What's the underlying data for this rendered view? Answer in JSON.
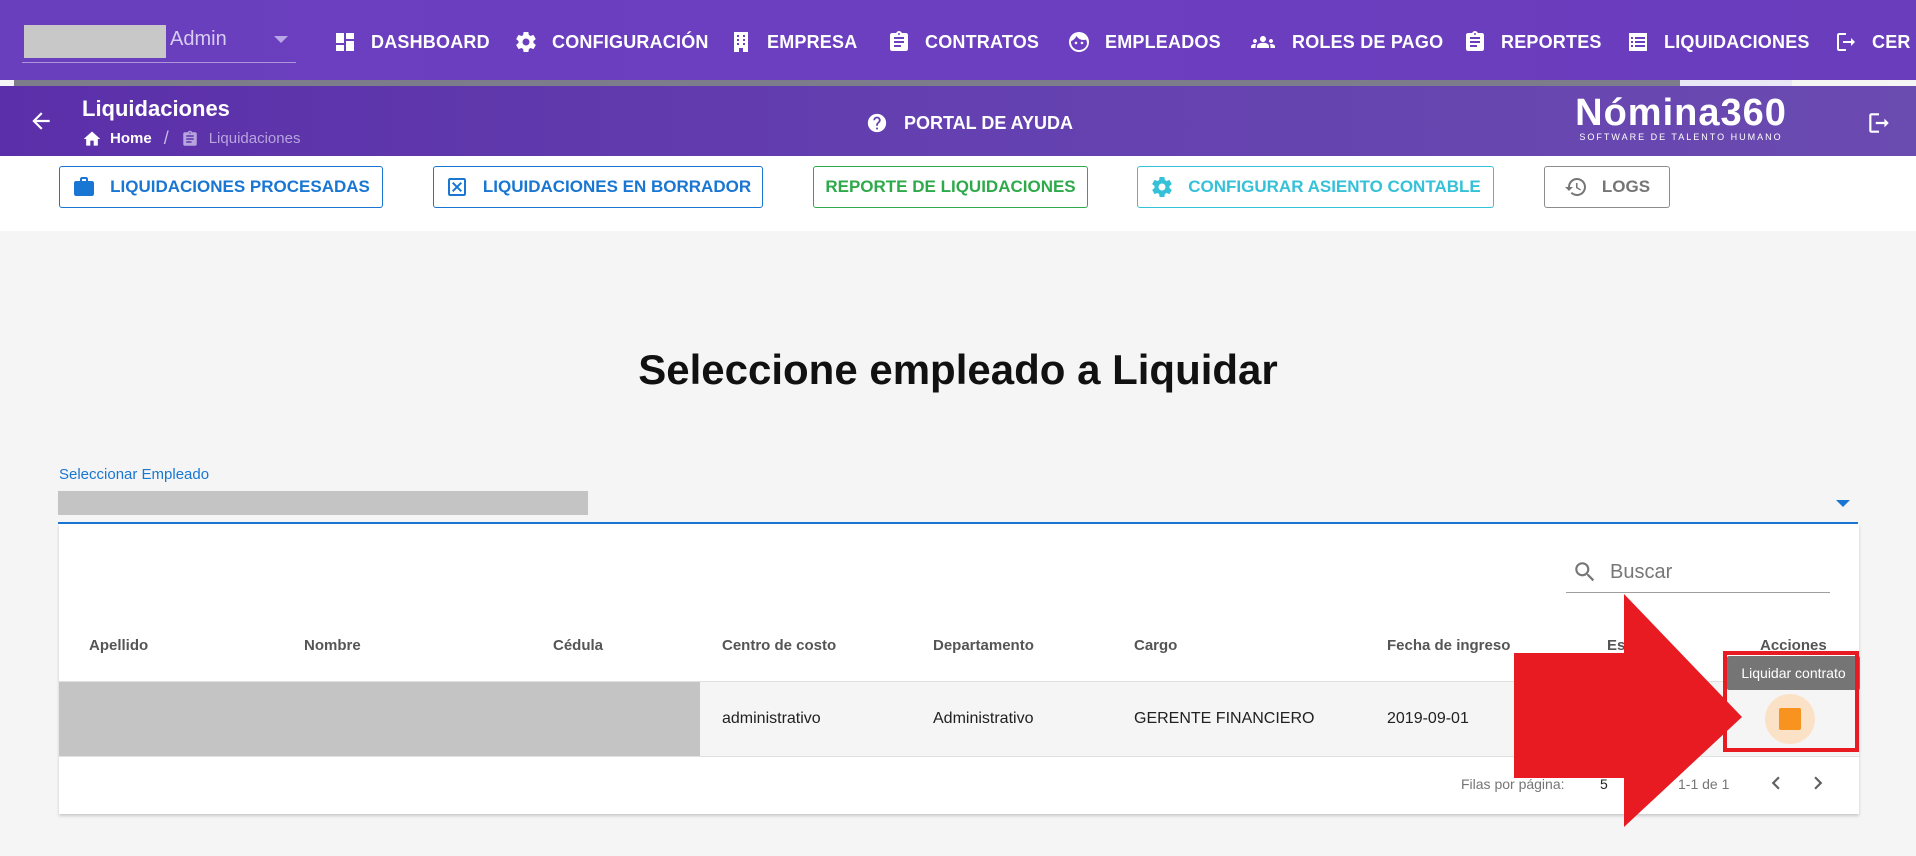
{
  "topnav": {
    "user_label": "Admin",
    "items": [
      {
        "label": "DASHBOARD",
        "icon": "dashboard-icon"
      },
      {
        "label": "CONFIGURACIÓN",
        "icon": "gear-icon"
      },
      {
        "label": "EMPRESA",
        "icon": "building-icon"
      },
      {
        "label": "CONTRATOS",
        "icon": "clipboard-icon"
      },
      {
        "label": "EMPLEADOS",
        "icon": "face-icon"
      },
      {
        "label": "ROLES DE PAGO",
        "icon": "people-icon"
      },
      {
        "label": "REPORTES",
        "icon": "clipboard-icon"
      },
      {
        "label": "LIQUIDACIONES",
        "icon": "list-icon"
      },
      {
        "label": "CER",
        "icon": "logout-icon"
      }
    ]
  },
  "subheader": {
    "title": "Liquidaciones",
    "breadcrumb_home": "Home",
    "breadcrumb_sep": "/",
    "breadcrumb_current": "Liquidaciones",
    "help_label": "PORTAL DE AYUDA",
    "brand_name": "Nómina360",
    "brand_tagline": "SOFTWARE DE TALENTO HUMANO"
  },
  "actions": {
    "processed": "LIQUIDACIONES PROCESADAS",
    "drafts": "LIQUIDACIONES EN BORRADOR",
    "report": "REPORTE DE LIQUIDACIONES",
    "accounting": "CONFIGURAR ASIENTO CONTABLE",
    "logs": "LOGS"
  },
  "main": {
    "heading": "Seleccione empleado a Liquidar",
    "select_label": "Seleccionar Empleado"
  },
  "table": {
    "search_placeholder": "Buscar",
    "columns": [
      "Apellido",
      "Nombre",
      "Cédula",
      "Centro de costo",
      "Departamento",
      "Cargo",
      "Fecha de ingreso",
      "Est",
      "Acciones"
    ],
    "rows": [
      {
        "centro_costo": "administrativo",
        "departamento": "Administrativo",
        "cargo": "GERENTE FINANCIERO",
        "fecha_ingreso": "2019-09-01"
      }
    ],
    "rows_per_page_label": "Filas por página:",
    "rows_per_page_value": "5",
    "range_label": "1-1 de 1",
    "action_tooltip": "Liquidar contrato"
  },
  "colors": {
    "nav_purple": "#6a3fbe",
    "primary_blue": "#1976d2",
    "success_green": "#2eaa4a",
    "info_cyan": "#35c1d8",
    "action_orange": "#f7931e",
    "annotation_red": "#e81b23"
  }
}
